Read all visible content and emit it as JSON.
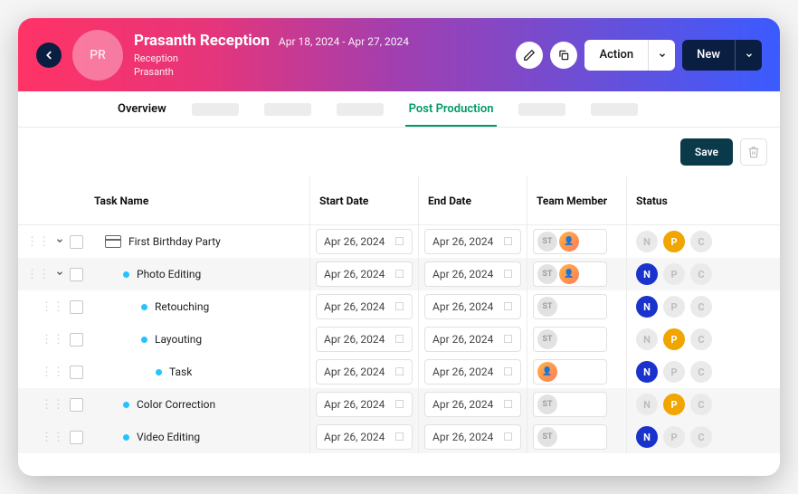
{
  "header": {
    "avatar_initials": "PR",
    "title": "Prasanth Reception",
    "date_range": "Apr 18, 2024 - Apr 27, 2024",
    "subtitle_1": "Reception",
    "subtitle_2": "Prasanth",
    "action_button": "Action",
    "new_button": "New"
  },
  "tabs": {
    "overview": "Overview",
    "post_production": "Post Production"
  },
  "toolbar": {
    "save": "Save"
  },
  "columns": {
    "task": "Task Name",
    "start": "Start Date",
    "end": "End Date",
    "team": "Team Member",
    "status": "Status"
  },
  "chart_data": {
    "type": "table",
    "columns": [
      "Task Name",
      "Start Date",
      "End Date",
      "Team Member",
      "Status"
    ],
    "rows": [
      {
        "name": "First Birthday Party",
        "indent": 0,
        "expandable": true,
        "start": "Apr 26, 2024",
        "end": "Apr 26, 2024",
        "team": [
          "ST",
          "avatar"
        ],
        "status": {
          "N": false,
          "P": true,
          "C": false
        }
      },
      {
        "name": "Photo Editing",
        "indent": 1,
        "expandable": true,
        "start": "Apr 26, 2024",
        "end": "Apr 26, 2024",
        "team": [
          "ST",
          "avatar"
        ],
        "status": {
          "N": true,
          "P": false,
          "C": false
        }
      },
      {
        "name": "Retouching",
        "indent": 2,
        "expandable": false,
        "start": "Apr 26, 2024",
        "end": "Apr 26, 2024",
        "team": [
          "ST"
        ],
        "status": {
          "N": true,
          "P": false,
          "C": false
        }
      },
      {
        "name": "Layouting",
        "indent": 2,
        "expandable": false,
        "start": "Apr 26, 2024",
        "end": "Apr 26, 2024",
        "team": [
          "ST"
        ],
        "status": {
          "N": false,
          "P": true,
          "C": false
        }
      },
      {
        "name": "Task",
        "indent": 3,
        "expandable": false,
        "start": "Apr 26, 2024",
        "end": "Apr 26, 2024",
        "team": [
          "avatar"
        ],
        "status": {
          "N": true,
          "P": false,
          "C": false
        }
      },
      {
        "name": "Color Correction",
        "indent": 1,
        "expandable": false,
        "start": "Apr 26, 2024",
        "end": "Apr 26, 2024",
        "team": [
          "ST"
        ],
        "status": {
          "N": false,
          "P": true,
          "C": false
        }
      },
      {
        "name": "Video Editing",
        "indent": 1,
        "expandable": false,
        "start": "Apr 26, 2024",
        "end": "Apr 26, 2024",
        "team": [
          "ST"
        ],
        "status": {
          "N": true,
          "P": false,
          "C": false
        }
      }
    ]
  },
  "rows": [
    {
      "name": "First Birthday Party",
      "start": "Apr 26, 2024",
      "end": "Apr 26, 2024"
    },
    {
      "name": "Photo Editing",
      "start": "Apr 26, 2024",
      "end": "Apr 26, 2024"
    },
    {
      "name": "Retouching",
      "start": "Apr 26, 2024",
      "end": "Apr 26, 2024"
    },
    {
      "name": "Layouting",
      "start": "Apr 26, 2024",
      "end": "Apr 26, 2024"
    },
    {
      "name": "Task",
      "start": "Apr 26, 2024",
      "end": "Apr 26, 2024"
    },
    {
      "name": "Color Correction",
      "start": "Apr 26, 2024",
      "end": "Apr 26, 2024"
    },
    {
      "name": "Video Editing",
      "start": "Apr 26, 2024",
      "end": "Apr 26, 2024"
    }
  ],
  "team_chip_label": "ST",
  "status_labels": {
    "N": "N",
    "P": "P",
    "C": "C"
  }
}
